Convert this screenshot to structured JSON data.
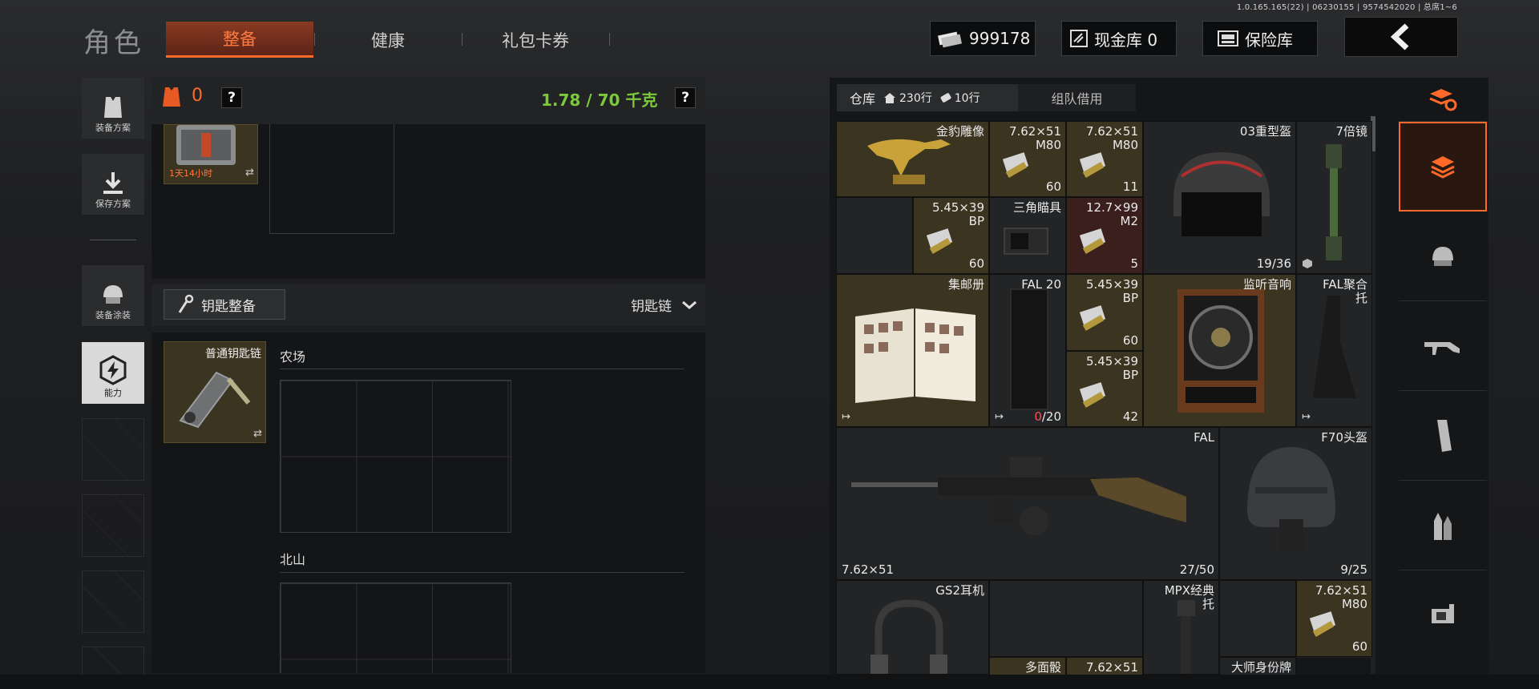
{
  "build_info": "1.0.165.165(22) | 06230155 | 9574542020 | 总席1~6",
  "title": "角色",
  "tabs": [
    {
      "label": "整备"
    },
    {
      "label": "健康"
    },
    {
      "label": "礼包卡券"
    }
  ],
  "currency": {
    "coins": "999178",
    "cash": "现金库 0",
    "safe": "保险库"
  },
  "left_nav": [
    {
      "label": "装备方案"
    },
    {
      "label": "保存方案"
    },
    {
      "label": "装备涂装"
    },
    {
      "label": "能力"
    }
  ],
  "loadout": {
    "armor_value": "0",
    "weight": "1.78 / 70 千克",
    "help": "?",
    "case_timer": "1天14小时"
  },
  "keys": {
    "button": "钥匙整备",
    "selector": "钥匙链",
    "keychain_name": "普通钥匙链",
    "zones": [
      "农场",
      "北山"
    ]
  },
  "warehouse": {
    "tab_storage": "仓库",
    "rows": "230行",
    "rows2": "10行",
    "tab_team": "组队借用",
    "items": [
      {
        "name": "金豹雕像"
      },
      {
        "name": "7.62×51 M80",
        "count": "60"
      },
      {
        "name": "7.62×51 M80",
        "count": "11"
      },
      {
        "name": "03重型盔",
        "count": "19/36"
      },
      {
        "name": "7倍镜"
      },
      {
        "name": "5.45×39 BP",
        "count": "60"
      },
      {
        "name": "三角瞄具"
      },
      {
        "name": "12.7×99 M2",
        "count": "5"
      },
      {
        "name": "集邮册"
      },
      {
        "name": "FAL 20",
        "count_red": "0",
        "count_rest": "/20"
      },
      {
        "name": "5.45×39 BP",
        "count": "60"
      },
      {
        "name": "5.45×39 BP",
        "count": "42"
      },
      {
        "name": "监听音响"
      },
      {
        "name": "FAL聚合托"
      },
      {
        "name": "FAL",
        "caliber": "7.62×51",
        "count": "27/50"
      },
      {
        "name": "F70头盔",
        "count": "9/25"
      },
      {
        "name": "GS2耳机"
      },
      {
        "name": "MPX经典托"
      },
      {
        "name": "7.62×51 M80",
        "count": "60"
      },
      {
        "name": "多面骰"
      },
      {
        "name": "7.62×51"
      },
      {
        "name": "大师身份牌"
      }
    ]
  },
  "colors": {
    "accent": "#ff6a2a",
    "weight_green": "#7cc93a",
    "gold_cell": "#3b3420"
  }
}
